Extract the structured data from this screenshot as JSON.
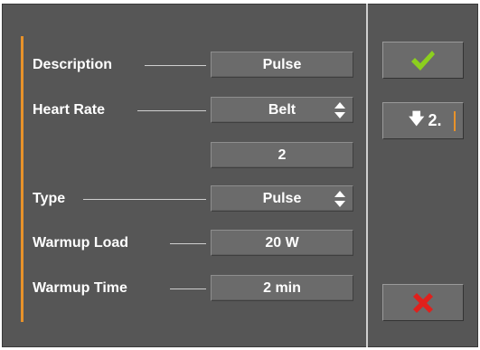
{
  "form": {
    "rows": [
      {
        "label": "Description",
        "value": "Pulse",
        "has_spinner": false
      },
      {
        "label": "Heart Rate",
        "value": "Belt",
        "has_spinner": true
      },
      {
        "label": "",
        "value": "2",
        "has_spinner": false
      },
      {
        "label": "Type",
        "value": "Pulse",
        "has_spinner": true
      },
      {
        "label": "Warmup Load",
        "value": "20 W",
        "has_spinner": false
      },
      {
        "label": "Warmup Time",
        "value": "2 min",
        "has_spinner": false
      }
    ]
  },
  "side": {
    "confirm_icon": "checkmark-icon",
    "next_arrow_icon": "arrow-down-icon",
    "next_label": "2.",
    "cancel_icon": "cross-icon"
  },
  "colors": {
    "panel": "#565656",
    "field": "#6b6b6b",
    "accent": "#e8922a",
    "check": "#8ccf1e",
    "cross": "#e0201c"
  }
}
